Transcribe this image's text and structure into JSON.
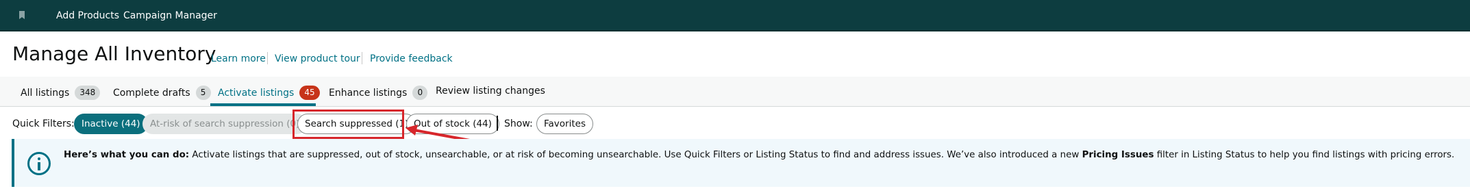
{
  "topnav": {
    "links": [
      "Add Products",
      "Campaign Manager"
    ]
  },
  "header": {
    "title": "Manage All Inventory",
    "links": [
      "Learn more",
      "View product tour",
      "Provide feedback"
    ]
  },
  "tabs": [
    {
      "label": "All listings",
      "count": "348"
    },
    {
      "label": "Complete drafts",
      "count": "5"
    },
    {
      "label": "Activate listings",
      "count": "45",
      "active": true
    },
    {
      "label": "Enhance listings",
      "count": "0"
    },
    {
      "label": "Review listing changes"
    }
  ],
  "quick_filters": {
    "label": "Quick Filters:",
    "pills": [
      "Inactive (44)",
      "At-risk of search suppression (0)",
      "Search suppressed (1)",
      "Out of stock (44)"
    ],
    "show_label": "Show:",
    "show_pill": "Favorites"
  },
  "info": {
    "lead": "Here’s what you can do:",
    "text_before_bold": "Activate listings that are suppressed, out of stock, unsearchable, or at risk of becoming unsearchable. Use Quick Filters or Listing Status to find and address issues. We’ve also introduced a new",
    "bold": "Pricing Issues",
    "text_after_bold": "filter in Listing Status to help you find listings with pricing errors."
  },
  "colors": {
    "nav_bg": "#0d3d40",
    "accent": "#007185",
    "active_count": "#c7341a",
    "annotation": "#d7262b"
  }
}
